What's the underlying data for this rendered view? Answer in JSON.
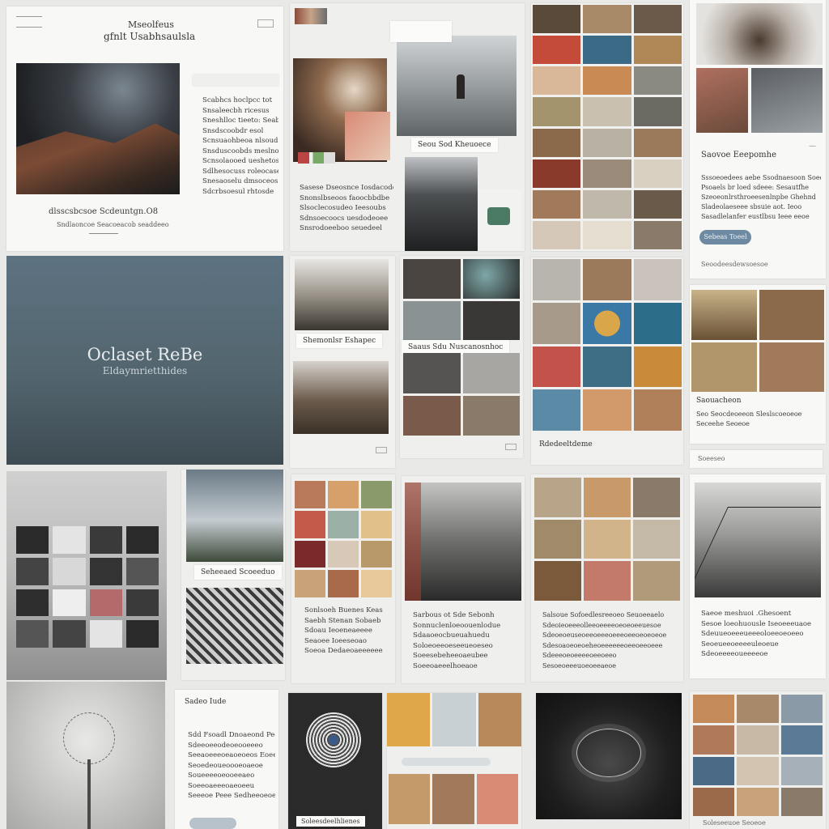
{
  "hero": {
    "title": "Oclaset ReBe",
    "subtitle": "Eldaymrietthides"
  },
  "cards": {
    "c1": {
      "header_line1": "Mseolfeus",
      "header_line2": "gfnlt Usabhsaulsla",
      "text_lines": [
        "Scabhcs hoclpcc tot",
        "Snsaleecbh ricesus",
        "Sneshlloc tieeto: Seaber",
        "Snsdscoobdr esol",
        "Scnsuaohbeoa nlsoudoco",
        "Snsduscoobds meslnolei",
        "Scnsolaooed ueshetos",
        "Sdlhesocuss roleocase",
        "Snesaoselu dmsoceos",
        "Sdcrbsoesul rhtosde"
      ],
      "caption_line1": "dlsscsbcsoe Scdeuntgn.Ö8",
      "caption_line2": "Sndlaoncoe Seacoeacob seaddeeo"
    },
    "c2": {
      "label": "Seou Sod Kheuoece",
      "text_lines": [
        "Sasese Dseosnce Iosdacodeoa",
        "Snonslbseoos faoocbbdbe",
        "Slsoclecosudeo Ieesoubs",
        "Sdnsoecoocs uesdodeoee",
        "Snsrodoeeboo seuedeel"
      ]
    },
    "c3": {
      "label_top": "Shemonlsr Eshapec",
      "label_mid": "Saaus Sdu Nuscanosnhoc"
    },
    "c4": {
      "caption": "Rdedeeltdeme"
    },
    "c5": {
      "title": "Saovoe Eeepomhe",
      "text_lines": [
        "Sssoeoedees aebe Ssodnaesoon Soeon",
        "Psoaels br loed sdeee: Sesautfhe",
        "Szeoeonlrsthroeesenlnpbe Ghehnd",
        "Sladeolaeseee sbsuie aot. Ieoo",
        "Sasadlelanfer eustlbsu Ieee eeoe"
      ],
      "button": "Sebeas Toeel",
      "footer": "Seoodeesdewsoesoe"
    },
    "c6": {
      "title": "Saouacheon",
      "line1": "Seo Seocdeoeeon  Sleslscoeoeoe",
      "line2": "Seceehe Seoeoe",
      "footer": "Soeeseo"
    },
    "c7": {
      "label": "Seheeaed Scoeeduo"
    },
    "c8": {
      "text_lines": [
        "Sonlsoeh Buenes Keas",
        "Saebh Stenan Sobaeb",
        "Sdoau Ieoeneaeeee",
        "Seaoee Ioeeseoao",
        "Soeoa Dedaeoaeeeeee"
      ]
    },
    "c9": {
      "text_lines": [
        "Sarbous ot Sde Sebonh",
        "Sonnuclenloeoouenlodue",
        "Sdaaoeocbueuahuedu",
        "Soloeoeeoeseeueoeseo",
        "Soeesebeheeoaeubee",
        "Soeeoaeeelhoeaoe"
      ]
    },
    "c10": {
      "text_lines": [
        "Salsoue Sofoedlesreeoeo Seuoeeaelo",
        "Sdeoieoeeeolleeoeeeeoeoeoeeuesoe",
        "Sdeoeoeuseoeeoeeeoeeeoeeoeoeoeoe",
        "Sdesoaoeoeoeheoeeeeeeoeeoeeoeee",
        "Sdeeeoeoeeeeoeeoeeo",
        "Sesoeoeeeuoeoeeaeoe"
      ]
    },
    "c11": {
      "text_lines": [
        "Saeoe meshuoi .Ghesoent",
        "Sesoe loeohuousle Iseoeeeuaoe",
        "Sdeuueoeeeueeeoloeeoeoeeo",
        "Seoeueeoeeeeuleoeue",
        "Sdeoeeeeoueeeeoe"
      ]
    },
    "c12": {
      "title": "Sadeo Iude",
      "text_lines": [
        "Sdd Fsoadl Dnoaeond Peoe",
        "Sdeeoeeodeoeooeeeo",
        "Seeaoeeeoeaoeoeos Eoeee",
        "Seoedeoueoooeoaeoe",
        "Soueeeeoeooeeaeo",
        "Soeeoaeeeoaeoeeu",
        "Seeeoe Peee Sedheeoeoe"
      ]
    },
    "c13": {
      "label": "Soleesdeelhlienes"
    },
    "c14": {
      "footer": "Soleseeuoe Seoeoe"
    }
  },
  "colors": {
    "hero_top": "#5d7281",
    "hero_bottom": "#3e4b53",
    "button_blue": "#6e8aa2",
    "page_bg": "#e9e9e7"
  },
  "icons": [
    "window-icon",
    "menu-lines-icon"
  ]
}
